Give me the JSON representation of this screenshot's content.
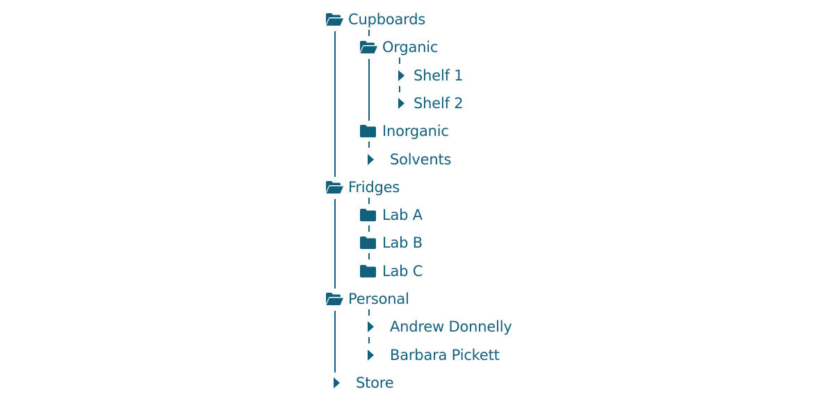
{
  "theme": {
    "accent": "#13607c",
    "background": "#ffffff"
  },
  "tree": [
    {
      "label": "Cupboards",
      "icon": "folder-open-icon",
      "expanded": true,
      "children": [
        {
          "label": "Organic",
          "icon": "folder-open-icon",
          "expanded": true,
          "children": [
            {
              "label": "Shelf 1",
              "icon": "caret-right-icon",
              "expanded": false
            },
            {
              "label": "Shelf 2",
              "icon": "caret-right-icon",
              "expanded": false
            }
          ]
        },
        {
          "label": "Inorganic",
          "icon": "folder-closed-icon",
          "expanded": false
        },
        {
          "label": "Solvents",
          "icon": "caret-right-icon",
          "expanded": false
        }
      ]
    },
    {
      "label": "Fridges",
      "icon": "folder-open-icon",
      "expanded": true,
      "children": [
        {
          "label": "Lab A",
          "icon": "folder-closed-icon",
          "expanded": false
        },
        {
          "label": "Lab B",
          "icon": "folder-closed-icon",
          "expanded": false
        },
        {
          "label": "Lab C",
          "icon": "folder-closed-icon",
          "expanded": false
        }
      ]
    },
    {
      "label": "Personal",
      "icon": "folder-open-icon",
      "expanded": true,
      "children": [
        {
          "label": "Andrew Donnelly",
          "icon": "caret-right-icon",
          "expanded": false
        },
        {
          "label": "Barbara Pickett",
          "icon": "caret-right-icon",
          "expanded": false
        }
      ]
    },
    {
      "label": "Store",
      "icon": "caret-right-icon",
      "expanded": false
    }
  ]
}
